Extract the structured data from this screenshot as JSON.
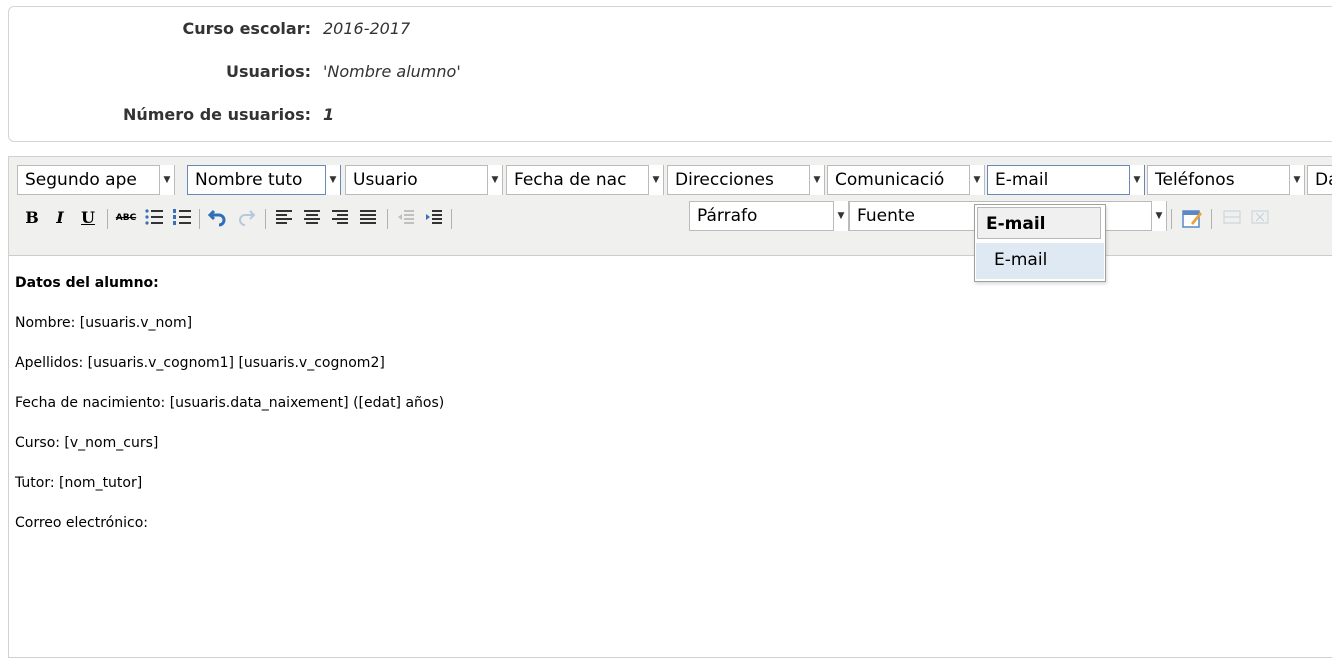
{
  "info": {
    "course_label": "Curso escolar:",
    "course_value": "2016-2017",
    "users_label": "Usuarios:",
    "users_value": "'Nombre alumno'",
    "count_label": "Número de usuarios:",
    "count_value": "1"
  },
  "toolbar": {
    "field_selects": [
      {
        "label": "Segundo ape"
      },
      {
        "label": "Nombre tuto"
      },
      {
        "label": "Usuario"
      },
      {
        "label": "Fecha de nac"
      },
      {
        "label": "Direcciones"
      },
      {
        "label": "Comunicació"
      },
      {
        "label": "E-mail"
      },
      {
        "label": "Teléfonos"
      },
      {
        "label": "Da"
      }
    ],
    "format_buttons": {
      "bold": "B",
      "italic": "I",
      "underline": "U",
      "strike": "ABC"
    },
    "block_format": "Párrafo",
    "font_select": "Fuente"
  },
  "email_dropdown": {
    "header": "E-mail",
    "options": [
      "E-mail"
    ]
  },
  "document": {
    "heading": "Datos del alumno:",
    "lines": [
      "Nombre: [usuaris.v_nom]",
      "Apellidos: [usuaris.v_cognom1] [usuaris.v_cognom2]",
      "Fecha de nacimiento: [usuaris.data_naixement] ([edat] años)",
      "Curso: [v_nom_curs]",
      "Tutor: [nom_tutor]",
      "Correo electrónico:"
    ]
  },
  "colors": {
    "toolbar_bg": "#f0f0ee",
    "dropdown_selected_bg": "#dfe9f4",
    "undo_blue": "#2f6fb8"
  }
}
